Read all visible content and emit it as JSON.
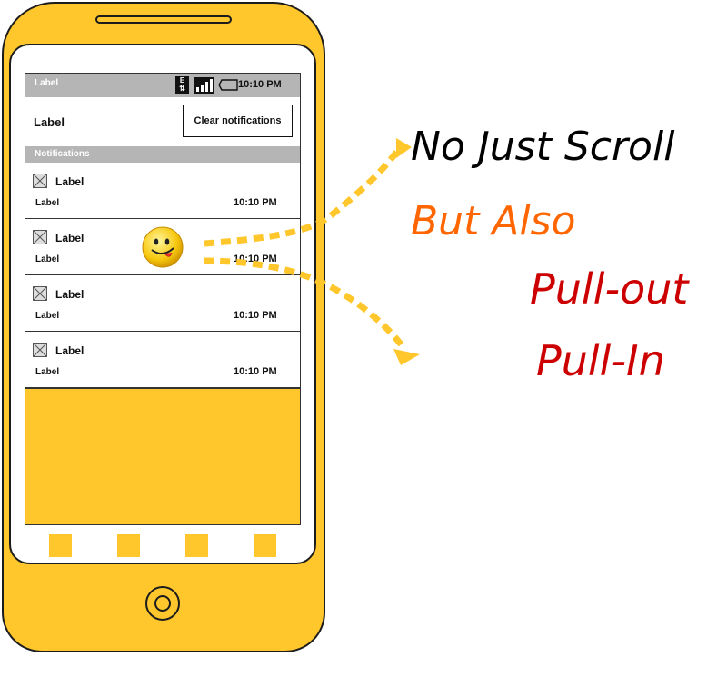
{
  "status_bar": {
    "label": "Label",
    "time": "10:10 PM",
    "signal_letter": "E"
  },
  "header": {
    "label": "Label",
    "clear_button": "Clear notifications"
  },
  "section": {
    "title": "Notifications"
  },
  "notifications": [
    {
      "title": "Label",
      "subtitle": "Label",
      "time": "10:10 PM"
    },
    {
      "title": "Label",
      "subtitle": "Label",
      "time": "10:10 PM"
    },
    {
      "title": "Label",
      "subtitle": "Label",
      "time": "10:10 PM"
    },
    {
      "title": "Label",
      "subtitle": "Label",
      "time": "10:10 PM"
    }
  ],
  "captions": {
    "line1": "No Just Scroll",
    "line2": "But Also",
    "line3": "Pull-out",
    "line4": "Pull-In"
  },
  "colors": {
    "phone": "#FFC72C",
    "arrow": "#FFC72C",
    "caption1": "#000000",
    "caption2": "#FF6600",
    "caption3": "#CC0000"
  },
  "icons": [
    "image-placeholder-icon",
    "smiley-icon",
    "signal-icon",
    "battery-icon",
    "home-button-icon"
  ]
}
